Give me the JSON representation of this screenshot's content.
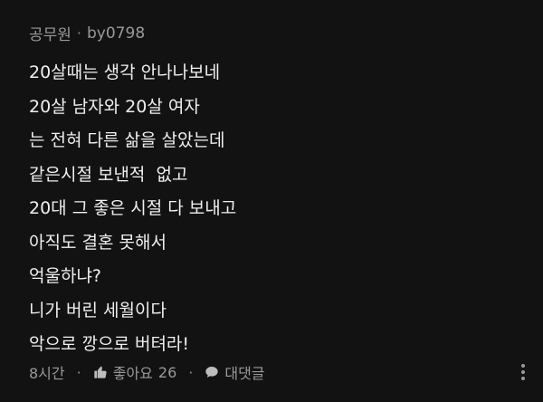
{
  "comment": {
    "category": "공무원",
    "separator": "·",
    "author": "by0798",
    "lines": [
      "20살때는 생각 안나나보네",
      "20살 남자와 20살 여자",
      "는 전혀 다른 삶을 살았는데",
      "같은시절 보낸적  없고",
      "20대 그 좋은 시절 다 보내고",
      "아직도 결혼 못해서",
      "억울하냐?",
      "니가 버린 세월이다",
      "악으로 깡으로 버텨라!"
    ],
    "time": "8시간",
    "like_label": "좋아요",
    "like_count": "26",
    "reply_label": "대댓글"
  },
  "icons": {
    "like": "thumbs-up-icon",
    "reply": "speech-bubble-icon",
    "more": "more-vertical-icon"
  },
  "colors": {
    "background": "#121212",
    "text": "#f0f0f0",
    "muted": "#9a9a9a"
  }
}
